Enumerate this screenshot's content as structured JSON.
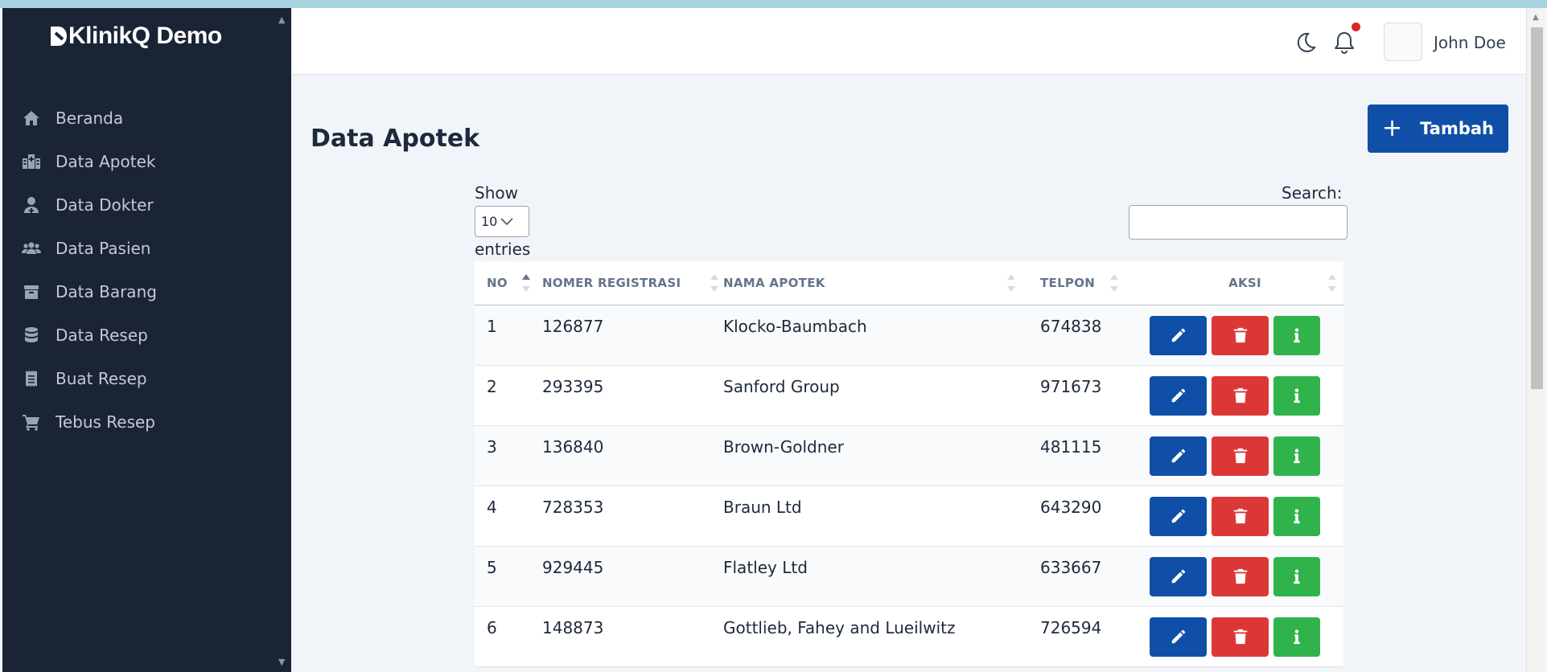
{
  "app": {
    "brand": "KlinikQ Demo"
  },
  "sidebar": {
    "items": [
      {
        "label": "Beranda",
        "icon": "home-icon"
      },
      {
        "label": "Data Apotek",
        "icon": "hospital-icon"
      },
      {
        "label": "Data Dokter",
        "icon": "doctor-icon"
      },
      {
        "label": "Data Pasien",
        "icon": "users-icon"
      },
      {
        "label": "Data Barang",
        "icon": "box-icon"
      },
      {
        "label": "Data Resep",
        "icon": "database-icon"
      },
      {
        "label": "Buat Resep",
        "icon": "receipt-icon"
      },
      {
        "label": "Tebus Resep",
        "icon": "cart-icon"
      }
    ]
  },
  "header": {
    "username": "John Doe",
    "notification_color": "#dc2626"
  },
  "main": {
    "title": "Data Apotek",
    "add_button": "Tambah",
    "show_label": "Show",
    "entries_value": "10",
    "entries_label": "entries",
    "search_label": "Search:",
    "search_value": ""
  },
  "table": {
    "columns": [
      "NO",
      "NOMER REGISTRASI",
      "NAMA APOTEK",
      "TELPON",
      "AKSI"
    ],
    "rows": [
      {
        "no": "1",
        "reg": "126877",
        "nama": "Klocko-Baumbach",
        "telpon": "674838"
      },
      {
        "no": "2",
        "reg": "293395",
        "nama": "Sanford Group",
        "telpon": "971673"
      },
      {
        "no": "3",
        "reg": "136840",
        "nama": "Brown-Goldner",
        "telpon": "481115"
      },
      {
        "no": "4",
        "reg": "728353",
        "nama": "Braun Ltd",
        "telpon": "643290"
      },
      {
        "no": "5",
        "reg": "929445",
        "nama": "Flatley Ltd",
        "telpon": "633667"
      },
      {
        "no": "6",
        "reg": "148873",
        "nama": "Gottlieb, Fahey and Lueilwitz",
        "telpon": "726594"
      }
    ]
  },
  "colors": {
    "primary": "#0f4fa8",
    "danger": "#dc3737",
    "success": "#2fb34a",
    "sidebar": "#1b2434"
  }
}
